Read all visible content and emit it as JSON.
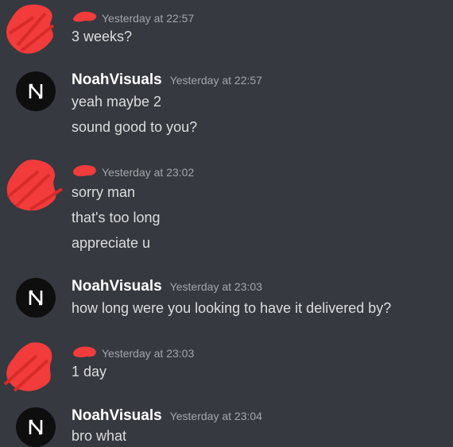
{
  "messages": [
    {
      "author": "",
      "timestamp": "Yesterday at 22:57",
      "lines": [
        "3 weeks?"
      ]
    },
    {
      "author": "NoahVisuals",
      "timestamp": "Yesterday at 22:57",
      "lines": [
        "yeah maybe 2",
        "sound good to you?"
      ]
    },
    {
      "author": "",
      "timestamp": "Yesterday at 23:02",
      "lines": [
        "sorry man",
        "that's too long",
        "appreciate u"
      ]
    },
    {
      "author": "NoahVisuals",
      "timestamp": "Yesterday at 23:03",
      "lines": [
        "how long were you looking to have it delivered by?"
      ]
    },
    {
      "author": "",
      "timestamp": "Yesterday at 23:03",
      "lines": [
        "1 day"
      ]
    },
    {
      "author": "NoahVisuals",
      "timestamp": "Yesterday at 23:04",
      "lines": [
        "bro what"
      ]
    }
  ],
  "colors": {
    "background": "#36393f",
    "redaction": "#f23b3b",
    "username": "#ffffff",
    "timestamp": "#a3a6aa",
    "text": "#dcddde"
  }
}
